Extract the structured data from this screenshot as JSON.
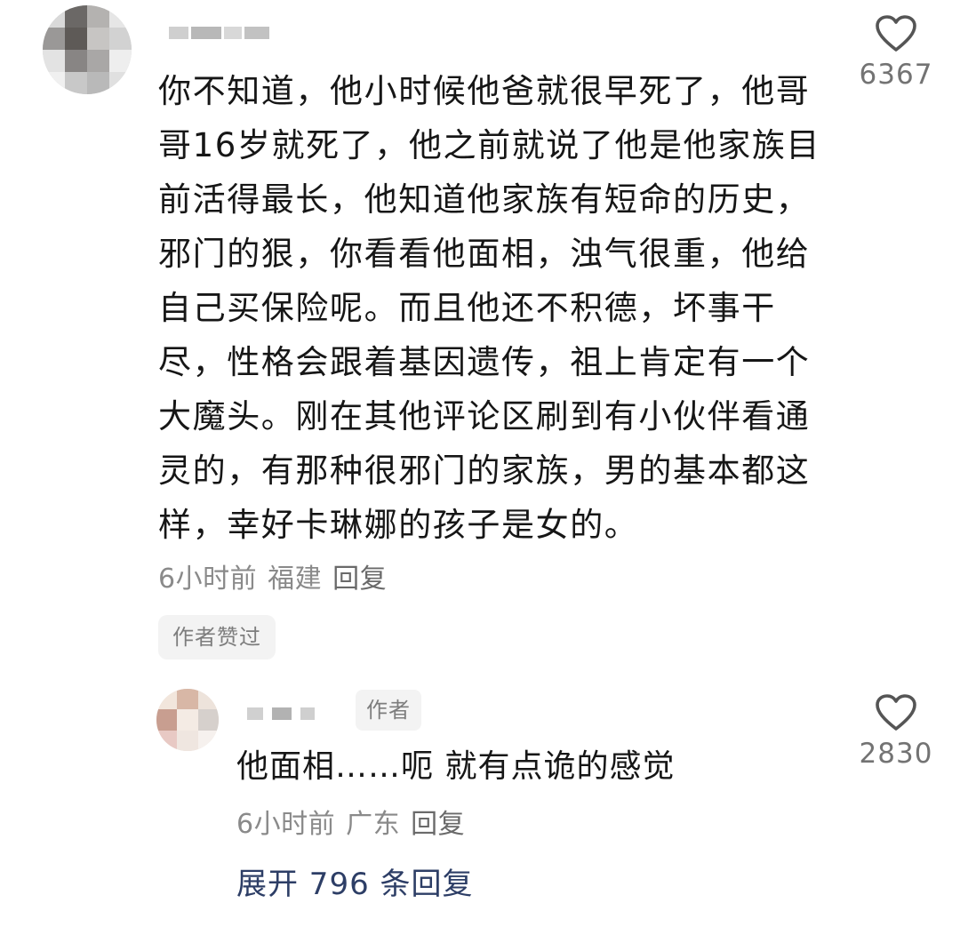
{
  "comment": {
    "text": "你不知道，他小时候他爸就很早死了，他哥哥16岁就死了，他之前就说了他是他家族目前活得最长，他知道他家族有短命的历史，邪门的狠，你看看他面相，浊气很重，他给自己买保险呢。而且他还不积德，坏事干尽，性格会跟着基因遗传，祖上肯定有一个大魔头。刚在其他评论区刷到有小伙伴看通灵的，有那种很邪门的家族，男的基本都这样，幸好卡琳娜的孩子是女的。",
    "time": "6小时前",
    "location": "福建",
    "reply_label": "回复",
    "author_liked_badge": "作者赞过",
    "like_count": "6367",
    "like_icon": "heart-outline-icon"
  },
  "reply": {
    "author_badge": "作者",
    "text": "他面相……呃 就有点诡的感觉",
    "time": "6小时前",
    "location": "广东",
    "reply_label": "回复",
    "like_count": "2830",
    "like_icon": "heart-outline-icon"
  },
  "expand_replies": {
    "label": "展开 796 条回复"
  },
  "colors": {
    "text_primary": "#161616",
    "text_meta": "#8a8a8a",
    "link_blue": "#2d3e66",
    "badge_bg": "#f3f3f3"
  }
}
